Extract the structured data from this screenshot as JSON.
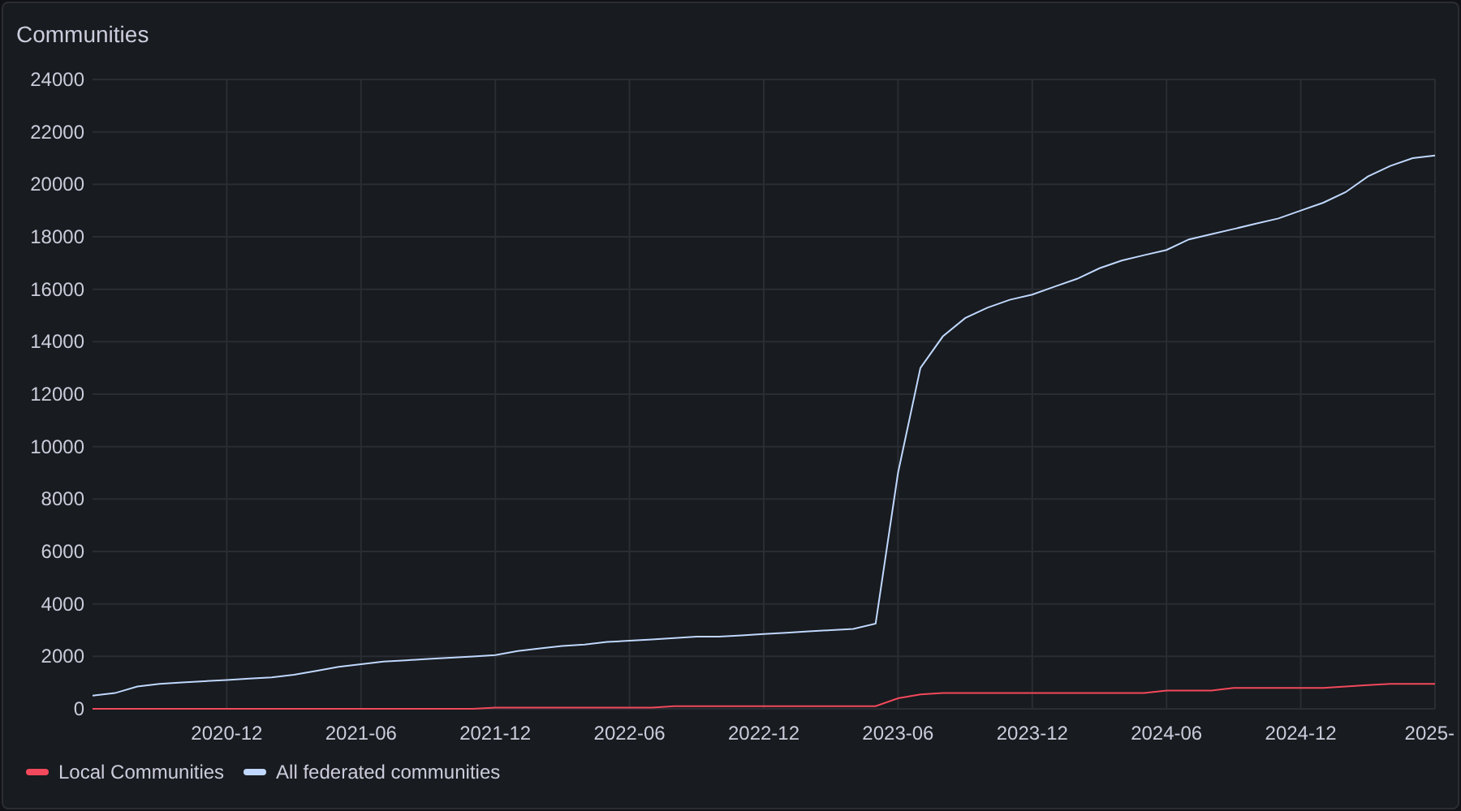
{
  "panel": {
    "title": "Communities",
    "chart_data": {
      "type": "line",
      "grid": true,
      "xlim": [
        "2020-06",
        "2025-06"
      ],
      "ylim": [
        0,
        24000
      ],
      "yticks": [
        0,
        2000,
        4000,
        6000,
        8000,
        10000,
        12000,
        14000,
        16000,
        18000,
        20000,
        22000,
        24000
      ],
      "xticks": [
        {
          "value": "2020-12",
          "label": "2020-12"
        },
        {
          "value": "2021-06",
          "label": "2021-06"
        },
        {
          "value": "2021-12",
          "label": "2021-12"
        },
        {
          "value": "2022-06",
          "label": "2022-06"
        },
        {
          "value": "2022-12",
          "label": "2022-12"
        },
        {
          "value": "2023-06",
          "label": "2023-06"
        },
        {
          "value": "2023-12",
          "label": "2023-12"
        },
        {
          "value": "2024-06",
          "label": "2024-06"
        },
        {
          "value": "2024-12",
          "label": "2024-12"
        },
        {
          "value": "2025-06",
          "label": "2025-"
        }
      ],
      "x": [
        "2020-06",
        "2020-07",
        "2020-08",
        "2020-09",
        "2020-10",
        "2020-11",
        "2020-12",
        "2021-01",
        "2021-02",
        "2021-03",
        "2021-04",
        "2021-05",
        "2021-06",
        "2021-07",
        "2021-08",
        "2021-09",
        "2021-10",
        "2021-11",
        "2021-12",
        "2022-01",
        "2022-02",
        "2022-03",
        "2022-04",
        "2022-05",
        "2022-06",
        "2022-07",
        "2022-08",
        "2022-09",
        "2022-10",
        "2022-11",
        "2022-12",
        "2023-01",
        "2023-02",
        "2023-03",
        "2023-04",
        "2023-05",
        "2023-06",
        "2023-07",
        "2023-08",
        "2023-09",
        "2023-10",
        "2023-11",
        "2023-12",
        "2024-01",
        "2024-02",
        "2024-03",
        "2024-04",
        "2024-05",
        "2024-06",
        "2024-07",
        "2024-08",
        "2024-09",
        "2024-10",
        "2024-11",
        "2024-12",
        "2025-01",
        "2025-02",
        "2025-03",
        "2025-04",
        "2025-05",
        "2025-06"
      ],
      "series": [
        {
          "name": "Local Communities",
          "color": "#f2495c",
          "values": [
            0,
            0,
            0,
            0,
            0,
            0,
            0,
            0,
            0,
            0,
            0,
            0,
            0,
            0,
            0,
            0,
            0,
            0,
            50,
            50,
            50,
            50,
            50,
            50,
            50,
            50,
            100,
            100,
            100,
            100,
            100,
            100,
            100,
            100,
            100,
            100,
            400,
            550,
            600,
            600,
            600,
            600,
            600,
            600,
            600,
            600,
            600,
            600,
            700,
            700,
            700,
            800,
            800,
            800,
            800,
            800,
            850,
            900,
            950,
            950,
            950
          ]
        },
        {
          "name": "All federated communities",
          "color": "#c0d8ff",
          "values": [
            500,
            600,
            850,
            950,
            1000,
            1050,
            1100,
            1150,
            1200,
            1300,
            1450,
            1600,
            1700,
            1800,
            1850,
            1900,
            1950,
            2000,
            2050,
            2200,
            2300,
            2400,
            2450,
            2550,
            2600,
            2650,
            2700,
            2750,
            2750,
            2800,
            2850,
            2900,
            2950,
            3000,
            3050,
            3250,
            9000,
            13000,
            14200,
            14900,
            15300,
            15600,
            15800,
            16100,
            16400,
            16800,
            17100,
            17300,
            17500,
            17900,
            18100,
            18300,
            18500,
            18700,
            19000,
            19300,
            19700,
            20300,
            20700,
            21000,
            21100
          ]
        }
      ]
    }
  }
}
